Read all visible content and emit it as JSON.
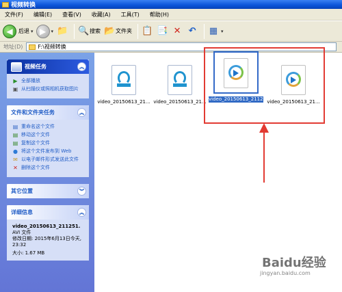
{
  "window": {
    "title": "视频转换"
  },
  "menu": [
    "文件(F)",
    "编辑(E)",
    "查看(V)",
    "收藏(A)",
    "工具(T)",
    "帮助(H)"
  ],
  "toolbar": {
    "back_label": "后退",
    "search_label": "搜索",
    "folders_label": "文件夹"
  },
  "address": {
    "label": "地址(D)",
    "value": "F:\\视频转换"
  },
  "video_tasks": {
    "title": "视频任务",
    "items": [
      "全部播放",
      "从扫描仪或照相机获取图片"
    ]
  },
  "file_tasks": {
    "title": "文件和文件夹任务",
    "items": [
      "重命名这个文件",
      "移动这个文件",
      "复制这个文件",
      "将这个文件发布到 Web",
      "以电子邮件形式发送此文件",
      "删除这个文件"
    ]
  },
  "other_places": {
    "title": "其它位置"
  },
  "details": {
    "title": "详细信息",
    "name": "video_20150613_211251.",
    "type": "AVI 文件",
    "modified": "修改日期: 2015年6月13日今天, 23:32",
    "size": "大小: 1.67 MB"
  },
  "files": [
    {
      "name": "video_20150613_21...",
      "icon": "media-file-icon"
    },
    {
      "name": "video_20150613_21...",
      "icon": "media-file-icon"
    },
    {
      "name": "video_20150613_211251.avi",
      "icon": "avi-file-icon",
      "selected": true
    },
    {
      "name": "video_20150613_21...",
      "icon": "avi-file-icon"
    }
  ],
  "watermark": {
    "logo": "Baidu经验",
    "url": "jingyan.baidu.com"
  },
  "colors": {
    "title_bar": "#0a53d8",
    "task_pane": "#6375d6",
    "selection": "#316ac5",
    "annotation": "#e23a32"
  }
}
